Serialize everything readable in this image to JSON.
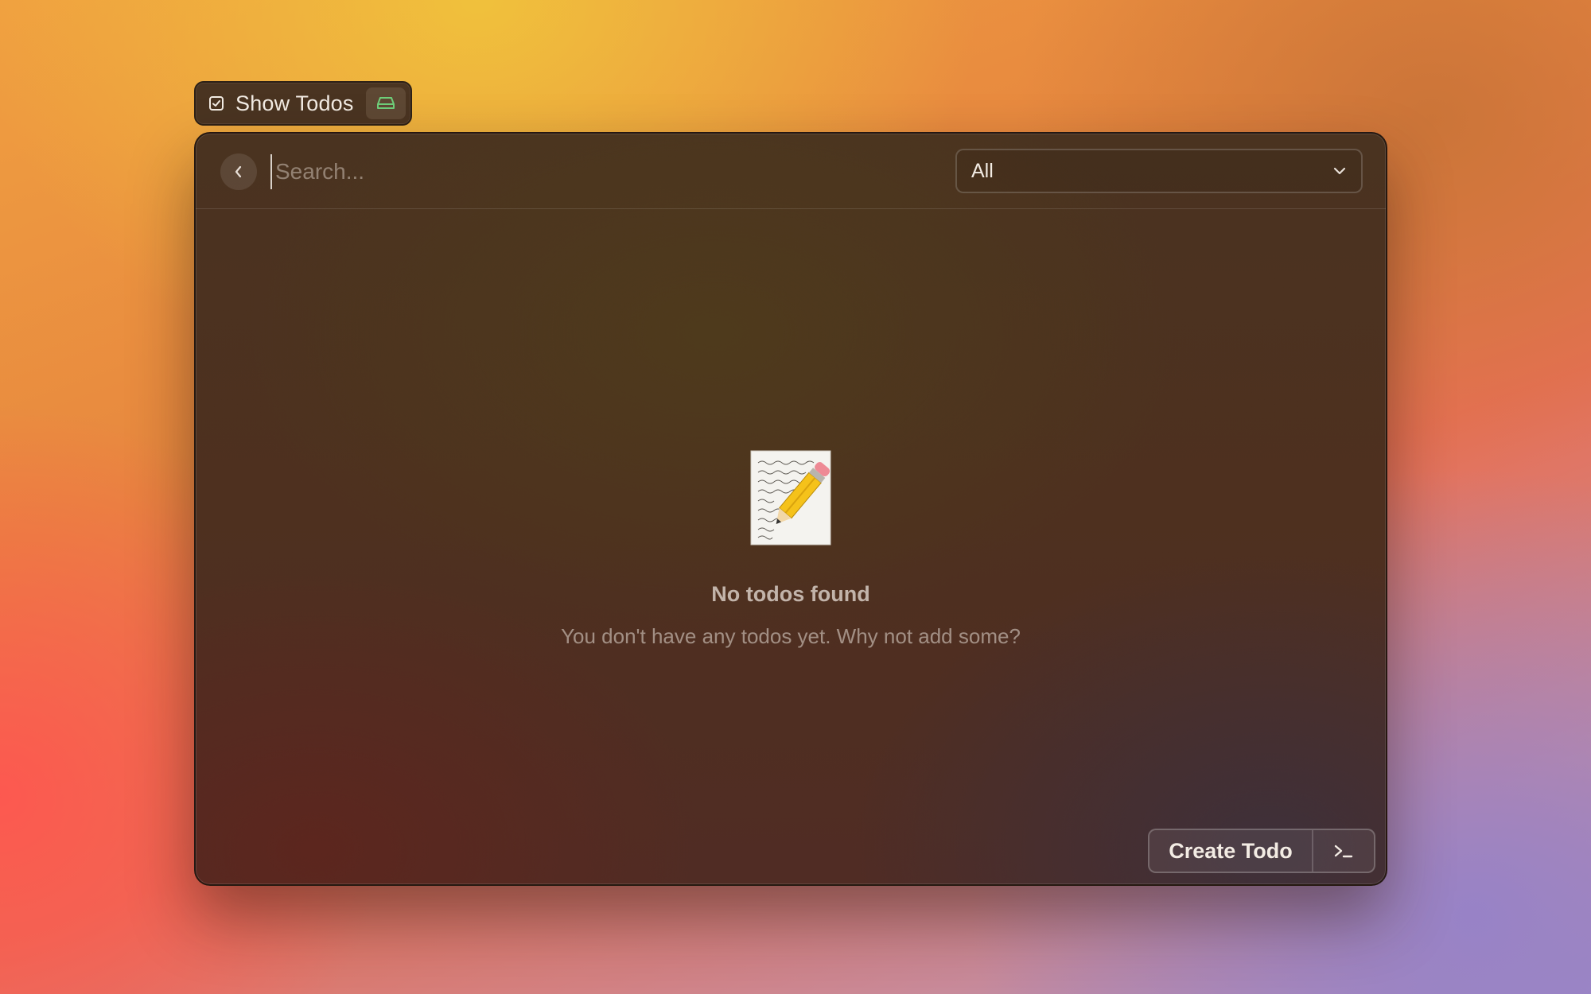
{
  "tab": {
    "title": "Show Todos",
    "icon": "checkbox-icon",
    "right_icon": "hard-drive-icon",
    "right_icon_color": "#6fcf7a"
  },
  "header": {
    "back_icon": "chevron-left-icon",
    "search_placeholder": "Search...",
    "search_value": "",
    "filter": {
      "selected": "All",
      "icon": "chevron-down-icon"
    }
  },
  "empty_state": {
    "icon": "memo-emoji",
    "title": "No todos found",
    "description": "You don't have any todos yet. Why not add some?"
  },
  "action": {
    "label": "Create Todo",
    "icon": "terminal-icon"
  },
  "colors": {
    "window_bg": "#4e301f",
    "text_primary": "#f3ece4"
  }
}
